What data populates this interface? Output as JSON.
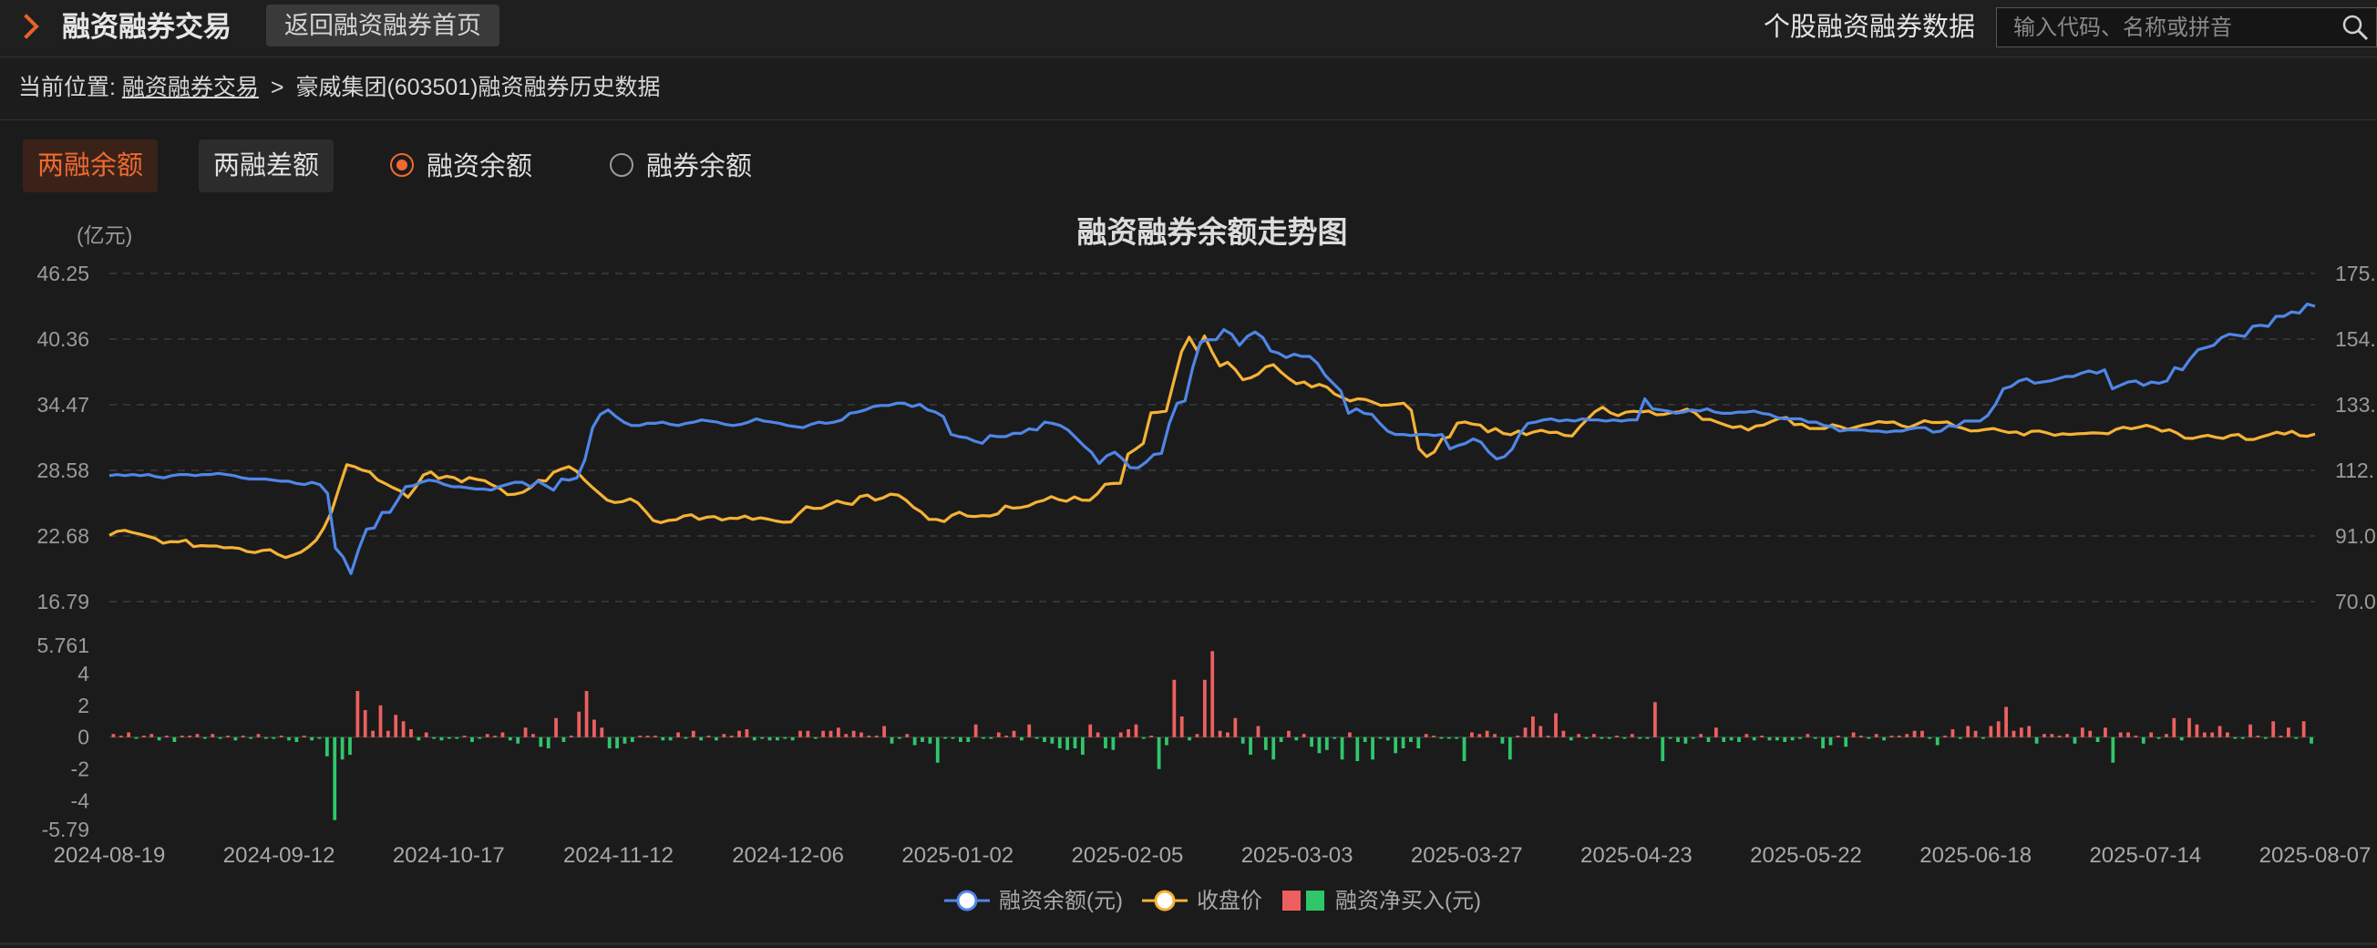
{
  "header": {
    "title": "融资融券交易",
    "back_label": "返回融资融券首页",
    "data_link": "个股融资融券数据",
    "search_placeholder": "输入代码、名称或拼音"
  },
  "breadcrumb": {
    "prefix": "当前位置:",
    "link": "融资融券交易",
    "sep": ">",
    "current": "豪威集团(603501)融资融券历史数据"
  },
  "tabs": [
    {
      "label": "两融余额",
      "active": true
    },
    {
      "label": "两融差额",
      "active": false
    }
  ],
  "radios": [
    {
      "label": "融资余额",
      "checked": true
    },
    {
      "label": "融券余额",
      "checked": false
    }
  ],
  "colors": {
    "accent": "#ef6a30",
    "financing_line": "#4f86e8",
    "price_line": "#f5b236",
    "bar_pos": "#ee5f5f",
    "bar_neg": "#2fc76a"
  },
  "chart_data": {
    "type": "line",
    "title": "融资融券余额走势图",
    "y_unit": "(亿元)",
    "x_ticks": [
      "2024-08-19",
      "2024-09-12",
      "2024-10-17",
      "2024-11-12",
      "2024-12-06",
      "2025-01-02",
      "2025-02-05",
      "2025-03-03",
      "2025-03-27",
      "2025-04-23",
      "2025-05-22",
      "2025-06-18",
      "2025-07-14",
      "2025-08-07"
    ],
    "y_left_ticks": [
      "46.25",
      "40.36",
      "34.47",
      "28.58",
      "22.68",
      "16.79"
    ],
    "y_left_range": [
      16.79,
      46.25
    ],
    "y_right_ticks": [
      "175.",
      "154.",
      "133.",
      "112.",
      "91.0",
      "70.0"
    ],
    "y_right_range": [
      70,
      175
    ],
    "bar_ticks": [
      "5.761",
      "4",
      "2",
      "0",
      "-2",
      "-4",
      "-5.79"
    ],
    "bar_range": [
      -5.79,
      5.761
    ],
    "grid": true,
    "legend": [
      {
        "label": "融资余额(元)",
        "kind": "line-blue"
      },
      {
        "label": "收盘价",
        "kind": "line-orange"
      },
      {
        "label": "融资净买入(元)",
        "kind": "bars"
      }
    ],
    "series": [
      {
        "name": "融资余额(元)",
        "axis": "left",
        "values": [
          28.1,
          28.2,
          28.1,
          28.2,
          28.1,
          28.2,
          28.0,
          27.9,
          28.1,
          28.2,
          28.2,
          28.1,
          28.2,
          28.2,
          28.3,
          28.2,
          28.1,
          27.9,
          27.8,
          27.8,
          27.8,
          27.7,
          27.6,
          27.6,
          27.4,
          27.3,
          27.5,
          27.3,
          26.5,
          21.6,
          20.8,
          19.3,
          21.5,
          23.3,
          23.4,
          24.8,
          24.8,
          25.9,
          27.1,
          27.2,
          27.5,
          27.7,
          27.6,
          27.3,
          27.1,
          27.1,
          27.0,
          26.9,
          26.9,
          26.8,
          27.1,
          27.3,
          27.5,
          27.5,
          27.1,
          27.6,
          27.2,
          26.8,
          27.8,
          27.7,
          27.9,
          29.5,
          32.4,
          33.6,
          34.0,
          33.4,
          32.9,
          32.6,
          32.6,
          32.8,
          32.8,
          32.9,
          32.7,
          32.6,
          32.8,
          32.9,
          33.1,
          33.0,
          32.9,
          32.7,
          32.6,
          32.7,
          32.9,
          33.2,
          33.0,
          32.9,
          32.8,
          32.6,
          32.5,
          32.4,
          32.7,
          32.9,
          32.8,
          32.9,
          33.1,
          33.7,
          33.8,
          34.0,
          34.3,
          34.4,
          34.4,
          34.6,
          34.6,
          34.3,
          34.5,
          34.0,
          33.8,
          33.4,
          31.8,
          31.6,
          31.5,
          31.2,
          31.0,
          31.7,
          31.6,
          31.6,
          31.9,
          31.9,
          32.3,
          32.2,
          32.9,
          32.8,
          32.6,
          32.2,
          31.5,
          30.8,
          30.2,
          29.2,
          29.9,
          30.2,
          29.6,
          28.8,
          28.8,
          29.3,
          30.0,
          30.1,
          32.8,
          34.6,
          34.8,
          37.8,
          40.1,
          40.3,
          40.3,
          41.2,
          40.8,
          39.8,
          40.6,
          41.0,
          40.5,
          39.3,
          39.1,
          38.7,
          39.0,
          38.8,
          38.8,
          38.2,
          37.1,
          36.4,
          35.7,
          33.7,
          34.1,
          33.7,
          33.6,
          32.8,
          32.1,
          31.8,
          31.8,
          31.7,
          31.8,
          31.8,
          31.7,
          31.8,
          30.5,
          30.8,
          31.0,
          31.4,
          31.1,
          30.2,
          29.6,
          29.8,
          30.5,
          31.9,
          32.8,
          32.9,
          33.1,
          33.2,
          33.0,
          33.1,
          33.0,
          33.2,
          33.1,
          33.1,
          33.0,
          33.1,
          33.0,
          33.1,
          33.1,
          35.0,
          34.1,
          34.0,
          33.9,
          33.7,
          33.8,
          34.0,
          33.9,
          34.1,
          33.8,
          33.7,
          33.7,
          33.8,
          33.8,
          33.9,
          33.7,
          33.6,
          33.3,
          33.2,
          33.2,
          33.2,
          32.9,
          32.9,
          32.6,
          32.5,
          32.1,
          32.2,
          32.2,
          32.2,
          32.1,
          32.1,
          32.0,
          32.1,
          32.1,
          32.3,
          32.4,
          32.4,
          32.0,
          32.1,
          32.6,
          32.5,
          33.0,
          33.0,
          33.0,
          33.5,
          34.5,
          35.9,
          36.1,
          36.6,
          36.8,
          36.4,
          36.5,
          36.6,
          36.8,
          37.0,
          37.0,
          37.3,
          37.5,
          37.3,
          37.6,
          35.9,
          36.2,
          36.5,
          36.6,
          36.2,
          36.5,
          36.4,
          36.6,
          37.8,
          37.6,
          38.6,
          39.4,
          39.6,
          39.8,
          40.5,
          40.8,
          40.7,
          40.6,
          41.5,
          41.6,
          41.5,
          42.4,
          42.4,
          42.8,
          42.7,
          43.5,
          43.3
        ]
      },
      {
        "name": "收盘价",
        "axis": "right",
        "values": [
          91.2,
          92.5,
          92.8,
          92.1,
          91.6,
          90.9,
          90.2,
          88.7,
          89.2,
          89.1,
          89.7,
          87.6,
          87.9,
          87.8,
          87.8,
          87.2,
          87.3,
          87.0,
          86.0,
          85.7,
          86.4,
          86.6,
          85.1,
          84.1,
          84.9,
          85.8,
          87.5,
          89.7,
          93.6,
          98.7,
          106.4,
          113.8,
          113.2,
          112.1,
          111.5,
          109.0,
          107.8,
          106.5,
          105.4,
          103.4,
          106.6,
          110.5,
          111.5,
          109.4,
          110.1,
          109.7,
          108.3,
          109.7,
          109.1,
          108.7,
          107.3,
          106.2,
          104.2,
          104.4,
          105.0,
          106.5,
          108.8,
          108.6,
          111.4,
          112.4,
          113.2,
          111.7,
          109.0,
          106.7,
          104.6,
          102.5,
          101.7,
          102.0,
          102.9,
          101.6,
          98.9,
          96.0,
          95.3,
          96.0,
          96.2,
          97.4,
          97.8,
          96.3,
          97.0,
          97.2,
          96.1,
          96.7,
          96.6,
          97.4,
          96.3,
          96.8,
          96.4,
          95.8,
          95.4,
          95.5,
          98.1,
          100.4,
          99.8,
          99.9,
          101.1,
          102.2,
          101.5,
          101.1,
          103.6,
          104.1,
          102.5,
          103.2,
          104.4,
          104.1,
          102.5,
          100.2,
          98.7,
          96.3,
          96.3,
          95.6,
          97.6,
          98.6,
          97.4,
          97.2,
          97.5,
          97.4,
          98.1,
          100.6,
          99.9,
          100.1,
          100.6,
          101.8,
          102.4,
          103.6,
          102.6,
          102.1,
          103.5,
          102.5,
          102.4,
          104.5,
          107.5,
          107.8,
          107.9,
          117.2,
          118.8,
          120.6,
          130.4,
          130.6,
          131.0,
          140.6,
          150.0,
          154.6,
          150.4,
          155.0,
          149.8,
          145.4,
          146.6,
          144.3,
          141.0,
          141.6,
          142.8,
          145.1,
          145.8,
          143.4,
          141.4,
          139.7,
          140.3,
          138.7,
          139.5,
          138.6,
          136.4,
          135.3,
          134.2,
          134.9,
          134.7,
          133.8,
          132.8,
          132.9,
          133.2,
          133.5,
          131.2,
          118.9,
          116.4,
          117.9,
          122.1,
          122.7,
          127.1,
          127.5,
          126.8,
          126.5,
          124.3,
          125.4,
          123.8,
          123.4,
          124.6,
          123.4,
          124.3,
          124.8,
          124.1,
          124.2,
          123.2,
          123.0,
          125.9,
          128.4,
          130.8,
          132.2,
          130.4,
          129.5,
          130.6,
          130.9,
          130.7,
          131.0,
          129.8,
          129.9,
          130.5,
          130.7,
          131.6,
          130.5,
          128.3,
          128.3,
          127.4,
          126.5,
          125.7,
          126.1,
          124.9,
          126.2,
          126.5,
          127.6,
          128.6,
          128.9,
          126.6,
          126.8,
          125.4,
          125.4,
          125.4,
          126.6,
          126.0,
          125.1,
          125.8,
          126.5,
          126.9,
          127.6,
          127.3,
          127.5,
          126.3,
          125.7,
          126.8,
          127.9,
          127.3,
          127.3,
          127.5,
          126.1,
          125.5,
          124.6,
          124.7,
          125.1,
          125.4,
          124.7,
          124.1,
          124.3,
          123.3,
          124.5,
          124.6,
          124.0,
          123.2,
          123.7,
          123.5,
          123.7,
          123.8,
          124.0,
          123.9,
          123.7,
          125.1,
          125.8,
          125.3,
          125.8,
          126.4,
          125.7,
          124.5,
          125.0,
          123.9,
          122.3,
          122.2,
          122.8,
          123.2,
          122.6,
          122.2,
          123.2,
          123.5,
          121.9,
          121.9,
          122.7,
          123.4,
          124.2,
          123.6,
          124.5,
          123.1,
          122.9,
          123.6
        ]
      },
      {
        "name": "融资净买入(元)",
        "axis": "bar",
        "type": "bar",
        "values": [
          0.2,
          0.1,
          0.3,
          -0.1,
          0.1,
          0.2,
          -0.2,
          0.1,
          -0.3,
          0.1,
          0.1,
          0.2,
          -0.1,
          0.2,
          -0.1,
          0.1,
          -0.2,
          0.1,
          -0.1,
          0.2,
          -0.1,
          -0.1,
          0.1,
          -0.2,
          -0.3,
          0.1,
          -0.2,
          -0.1,
          -1.2,
          -5.2,
          -1.4,
          -1.1,
          2.9,
          1.7,
          0.4,
          2.0,
          0.4,
          1.4,
          1.0,
          0.5,
          -0.2,
          0.3,
          -0.1,
          -0.2,
          -0.1,
          -0.1,
          0.1,
          -0.3,
          -0.1,
          0.2,
          0.1,
          0.3,
          -0.2,
          -0.4,
          0.6,
          0.2,
          -0.6,
          -0.7,
          1.2,
          -0.3,
          0.1,
          1.6,
          2.9,
          1.1,
          0.6,
          -0.7,
          -0.7,
          -0.4,
          -0.3,
          0.1,
          0.1,
          0.1,
          -0.2,
          -0.2,
          0.3,
          -0.1,
          0.4,
          -0.2,
          0.1,
          -0.2,
          0.2,
          0.1,
          0.4,
          0.5,
          -0.2,
          -0.1,
          -0.2,
          -0.2,
          -0.1,
          -0.2,
          0.4,
          0.4,
          -0.1,
          0.4,
          0.4,
          0.6,
          0.2,
          0.4,
          0.3,
          0.1,
          0.1,
          0.7,
          -0.4,
          -0.1,
          0.2,
          -0.5,
          -0.3,
          -0.4,
          -1.6,
          -0.1,
          -0.1,
          -0.3,
          -0.3,
          0.8,
          -0.1,
          -0.1,
          0.3,
          0.1,
          0.4,
          -0.2,
          0.8,
          -0.1,
          -0.3,
          -0.4,
          -0.7,
          -0.8,
          -0.7,
          -1.1,
          0.8,
          0.3,
          -0.7,
          -0.8,
          0.3,
          0.5,
          0.8,
          -0.1,
          0.1,
          -2.0,
          -0.5,
          3.6,
          1.3,
          -0.2,
          0.2,
          3.6,
          5.4,
          0.4,
          0.3,
          1.2,
          -0.4,
          -1.1,
          0.7,
          -0.8,
          -1.4,
          -0.3,
          0.4,
          -0.2,
          0.2,
          -0.6,
          -1.0,
          -0.8,
          -0.1,
          -1.4,
          0.3,
          -1.5,
          -0.3,
          -1.4,
          -0.1,
          -0.2,
          -1.0,
          -0.7,
          -0.3,
          -0.7,
          0.2,
          0.1,
          -0.1,
          -0.1,
          -0.1,
          -1.5,
          0.3,
          0.2,
          0.4,
          0.2,
          -0.4,
          -1.4,
          0.1,
          0.6,
          1.3,
          0.7,
          0.1,
          1.5,
          0.4,
          -0.2,
          0.2,
          -0.1,
          0.2,
          -0.1,
          -0.1,
          0.1,
          -0.1,
          0.2,
          -0.1,
          -0.1,
          2.2,
          -1.5,
          -0.1,
          -0.3,
          -0.4,
          -0.1,
          0.2,
          -0.3,
          0.6,
          -0.3,
          -0.2,
          -0.3,
          0.2,
          -0.2,
          0.1,
          -0.2,
          -0.2,
          -0.3,
          -0.2,
          -0.1,
          0.2,
          -0.1,
          -0.7,
          -0.5,
          0.1,
          -0.6,
          0.3,
          0.1,
          -0.1,
          0.2,
          -0.2,
          0.1,
          0.1,
          0.2,
          0.4,
          0.4,
          -0.1,
          -0.5,
          0.1,
          0.5,
          -0.1,
          0.7,
          0.4,
          -0.1,
          0.7,
          1.0,
          1.9,
          0.4,
          0.6,
          0.7,
          -0.4,
          0.2,
          0.2,
          0.1,
          0.2,
          -0.4,
          0.6,
          0.4,
          -0.3,
          0.6,
          -1.6,
          0.3,
          0.3,
          0.1,
          -0.4,
          0.3,
          -0.1,
          0.2,
          1.2,
          -0.2,
          1.2,
          0.8,
          0.3,
          0.3,
          0.7,
          0.3,
          -0.1,
          -0.1,
          0.8,
          0.1,
          -0.1,
          1.0,
          0.1,
          0.6,
          -0.1,
          1.0,
          -0.4
        ]
      }
    ]
  }
}
